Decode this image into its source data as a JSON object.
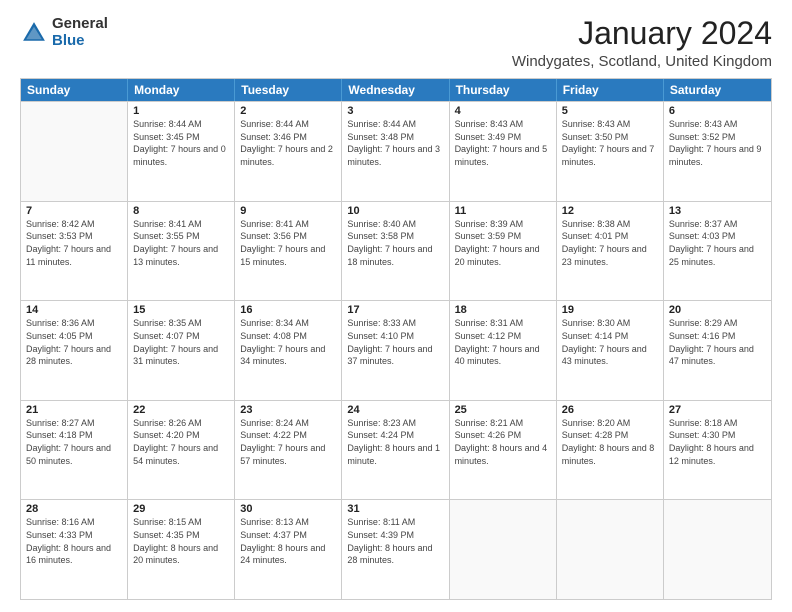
{
  "header": {
    "logo_general": "General",
    "logo_blue": "Blue",
    "title": "January 2024",
    "location": "Windygates, Scotland, United Kingdom"
  },
  "calendar": {
    "days": [
      "Sunday",
      "Monday",
      "Tuesday",
      "Wednesday",
      "Thursday",
      "Friday",
      "Saturday"
    ],
    "rows": [
      [
        {
          "day": "",
          "empty": true
        },
        {
          "day": "1",
          "sunrise": "Sunrise: 8:44 AM",
          "sunset": "Sunset: 3:45 PM",
          "daylight": "Daylight: 7 hours and 0 minutes."
        },
        {
          "day": "2",
          "sunrise": "Sunrise: 8:44 AM",
          "sunset": "Sunset: 3:46 PM",
          "daylight": "Daylight: 7 hours and 2 minutes."
        },
        {
          "day": "3",
          "sunrise": "Sunrise: 8:44 AM",
          "sunset": "Sunset: 3:48 PM",
          "daylight": "Daylight: 7 hours and 3 minutes."
        },
        {
          "day": "4",
          "sunrise": "Sunrise: 8:43 AM",
          "sunset": "Sunset: 3:49 PM",
          "daylight": "Daylight: 7 hours and 5 minutes."
        },
        {
          "day": "5",
          "sunrise": "Sunrise: 8:43 AM",
          "sunset": "Sunset: 3:50 PM",
          "daylight": "Daylight: 7 hours and 7 minutes."
        },
        {
          "day": "6",
          "sunrise": "Sunrise: 8:43 AM",
          "sunset": "Sunset: 3:52 PM",
          "daylight": "Daylight: 7 hours and 9 minutes."
        }
      ],
      [
        {
          "day": "7",
          "sunrise": "Sunrise: 8:42 AM",
          "sunset": "Sunset: 3:53 PM",
          "daylight": "Daylight: 7 hours and 11 minutes."
        },
        {
          "day": "8",
          "sunrise": "Sunrise: 8:41 AM",
          "sunset": "Sunset: 3:55 PM",
          "daylight": "Daylight: 7 hours and 13 minutes."
        },
        {
          "day": "9",
          "sunrise": "Sunrise: 8:41 AM",
          "sunset": "Sunset: 3:56 PM",
          "daylight": "Daylight: 7 hours and 15 minutes."
        },
        {
          "day": "10",
          "sunrise": "Sunrise: 8:40 AM",
          "sunset": "Sunset: 3:58 PM",
          "daylight": "Daylight: 7 hours and 18 minutes."
        },
        {
          "day": "11",
          "sunrise": "Sunrise: 8:39 AM",
          "sunset": "Sunset: 3:59 PM",
          "daylight": "Daylight: 7 hours and 20 minutes."
        },
        {
          "day": "12",
          "sunrise": "Sunrise: 8:38 AM",
          "sunset": "Sunset: 4:01 PM",
          "daylight": "Daylight: 7 hours and 23 minutes."
        },
        {
          "day": "13",
          "sunrise": "Sunrise: 8:37 AM",
          "sunset": "Sunset: 4:03 PM",
          "daylight": "Daylight: 7 hours and 25 minutes."
        }
      ],
      [
        {
          "day": "14",
          "sunrise": "Sunrise: 8:36 AM",
          "sunset": "Sunset: 4:05 PM",
          "daylight": "Daylight: 7 hours and 28 minutes."
        },
        {
          "day": "15",
          "sunrise": "Sunrise: 8:35 AM",
          "sunset": "Sunset: 4:07 PM",
          "daylight": "Daylight: 7 hours and 31 minutes."
        },
        {
          "day": "16",
          "sunrise": "Sunrise: 8:34 AM",
          "sunset": "Sunset: 4:08 PM",
          "daylight": "Daylight: 7 hours and 34 minutes."
        },
        {
          "day": "17",
          "sunrise": "Sunrise: 8:33 AM",
          "sunset": "Sunset: 4:10 PM",
          "daylight": "Daylight: 7 hours and 37 minutes."
        },
        {
          "day": "18",
          "sunrise": "Sunrise: 8:31 AM",
          "sunset": "Sunset: 4:12 PM",
          "daylight": "Daylight: 7 hours and 40 minutes."
        },
        {
          "day": "19",
          "sunrise": "Sunrise: 8:30 AM",
          "sunset": "Sunset: 4:14 PM",
          "daylight": "Daylight: 7 hours and 43 minutes."
        },
        {
          "day": "20",
          "sunrise": "Sunrise: 8:29 AM",
          "sunset": "Sunset: 4:16 PM",
          "daylight": "Daylight: 7 hours and 47 minutes."
        }
      ],
      [
        {
          "day": "21",
          "sunrise": "Sunrise: 8:27 AM",
          "sunset": "Sunset: 4:18 PM",
          "daylight": "Daylight: 7 hours and 50 minutes."
        },
        {
          "day": "22",
          "sunrise": "Sunrise: 8:26 AM",
          "sunset": "Sunset: 4:20 PM",
          "daylight": "Daylight: 7 hours and 54 minutes."
        },
        {
          "day": "23",
          "sunrise": "Sunrise: 8:24 AM",
          "sunset": "Sunset: 4:22 PM",
          "daylight": "Daylight: 7 hours and 57 minutes."
        },
        {
          "day": "24",
          "sunrise": "Sunrise: 8:23 AM",
          "sunset": "Sunset: 4:24 PM",
          "daylight": "Daylight: 8 hours and 1 minute."
        },
        {
          "day": "25",
          "sunrise": "Sunrise: 8:21 AM",
          "sunset": "Sunset: 4:26 PM",
          "daylight": "Daylight: 8 hours and 4 minutes."
        },
        {
          "day": "26",
          "sunrise": "Sunrise: 8:20 AM",
          "sunset": "Sunset: 4:28 PM",
          "daylight": "Daylight: 8 hours and 8 minutes."
        },
        {
          "day": "27",
          "sunrise": "Sunrise: 8:18 AM",
          "sunset": "Sunset: 4:30 PM",
          "daylight": "Daylight: 8 hours and 12 minutes."
        }
      ],
      [
        {
          "day": "28",
          "sunrise": "Sunrise: 8:16 AM",
          "sunset": "Sunset: 4:33 PM",
          "daylight": "Daylight: 8 hours and 16 minutes."
        },
        {
          "day": "29",
          "sunrise": "Sunrise: 8:15 AM",
          "sunset": "Sunset: 4:35 PM",
          "daylight": "Daylight: 8 hours and 20 minutes."
        },
        {
          "day": "30",
          "sunrise": "Sunrise: 8:13 AM",
          "sunset": "Sunset: 4:37 PM",
          "daylight": "Daylight: 8 hours and 24 minutes."
        },
        {
          "day": "31",
          "sunrise": "Sunrise: 8:11 AM",
          "sunset": "Sunset: 4:39 PM",
          "daylight": "Daylight: 8 hours and 28 minutes."
        },
        {
          "day": "",
          "empty": true
        },
        {
          "day": "",
          "empty": true
        },
        {
          "day": "",
          "empty": true
        }
      ]
    ]
  }
}
